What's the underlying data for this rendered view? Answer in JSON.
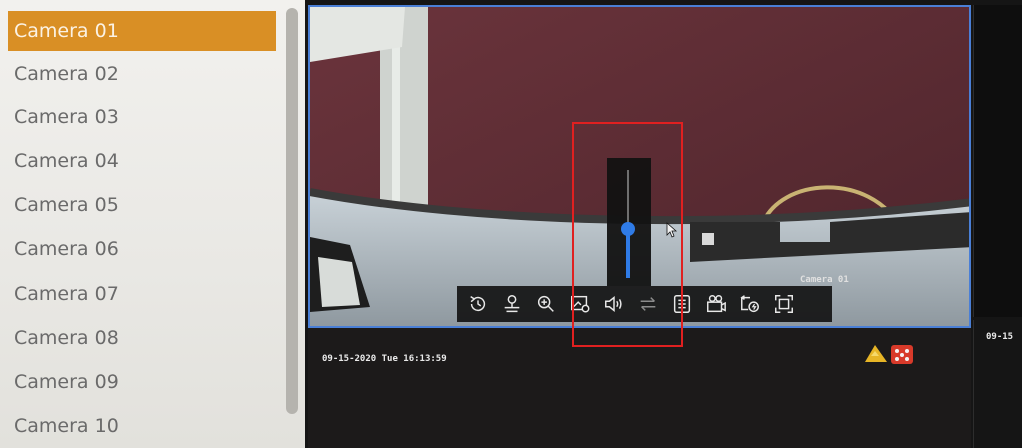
{
  "camera_list": {
    "items": [
      {
        "label": "Camera 01",
        "selected": true
      },
      {
        "label": "Camera 02",
        "selected": false
      },
      {
        "label": "Camera 03",
        "selected": false
      },
      {
        "label": "Camera 04",
        "selected": false
      },
      {
        "label": "Camera 05",
        "selected": false
      },
      {
        "label": "Camera 06",
        "selected": false
      },
      {
        "label": "Camera 07",
        "selected": false
      },
      {
        "label": "Camera 08",
        "selected": false
      },
      {
        "label": "Camera 09",
        "selected": false
      },
      {
        "label": "Camera 10",
        "selected": false
      }
    ]
  },
  "main_view": {
    "camera_name": "Camera 01"
  },
  "bottom_view": {
    "datetime": "09-15-2020 Tue 16:13:59"
  },
  "right_bottom_view": {
    "datetime_partial": "09-15"
  },
  "toolbar": {
    "buttons": [
      {
        "icon": "instant-playback-icon"
      },
      {
        "icon": "digital-zoom-icon"
      },
      {
        "icon": "zoom-in-icon"
      },
      {
        "icon": "image-settings-icon"
      },
      {
        "icon": "audio-icon"
      },
      {
        "icon": "switch-stream-icon"
      },
      {
        "icon": "information-icon"
      },
      {
        "icon": "manual-record-icon"
      },
      {
        "icon": "quick-playback-icon"
      },
      {
        "icon": "fullscreen-icon"
      }
    ]
  },
  "volume": {
    "level": 0.45
  },
  "colors": {
    "selected_item": "#d98f25",
    "volume_accent": "#2f7be6",
    "highlight_box": "#e02020",
    "active_tile_border": "#4a7fd6"
  }
}
